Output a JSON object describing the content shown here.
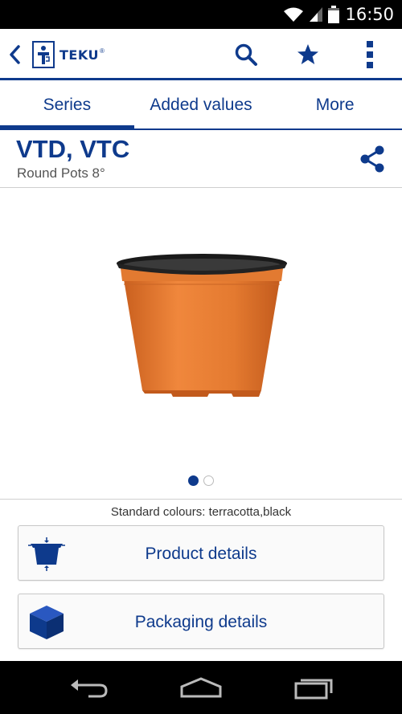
{
  "status_bar": {
    "time": "16:50"
  },
  "action_bar": {
    "logo_text": "TEKU",
    "logo_mark": "®"
  },
  "tabs": [
    {
      "label": "Series",
      "active": true
    },
    {
      "label": "Added values",
      "active": false
    },
    {
      "label": "More",
      "active": false
    }
  ],
  "product": {
    "title": "VTD, VTC",
    "subtitle": "Round Pots 8°"
  },
  "gallery": {
    "pages": 2,
    "current_page": 1
  },
  "colours_text": "Standard colours: terracotta,black",
  "buttons": {
    "product_details": "Product details",
    "packaging_details": "Packaging details"
  },
  "colors": {
    "accent": "#0e3a8c",
    "pot": "#e2792f"
  }
}
